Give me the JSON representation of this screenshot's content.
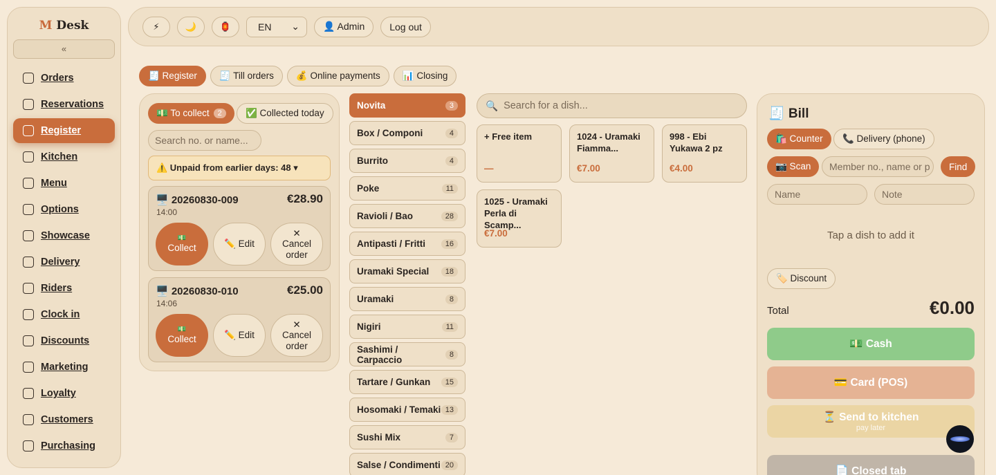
{
  "sidebar": {
    "logo_mark": "M",
    "logo_text": "Desk",
    "collapse_label": "«",
    "items": [
      {
        "label": "Orders",
        "icon": "clipboard-icon"
      },
      {
        "label": "Reservations",
        "icon": "calendar-icon"
      },
      {
        "label": "Register",
        "icon": "calculator-icon",
        "active": true
      },
      {
        "label": "Kitchen",
        "icon": "chef-hat-icon"
      },
      {
        "label": "Menu",
        "icon": "book-icon"
      },
      {
        "label": "Options",
        "icon": "list-check-icon"
      },
      {
        "label": "Showcase",
        "icon": "monitor-icon"
      },
      {
        "label": "Delivery",
        "icon": "truck-icon"
      },
      {
        "label": "Riders",
        "icon": "bike-icon"
      },
      {
        "label": "Clock in",
        "icon": "clock-icon"
      },
      {
        "label": "Discounts",
        "icon": "ticket-icon"
      },
      {
        "label": "Marketing",
        "icon": "megaphone-icon"
      },
      {
        "label": "Loyalty",
        "icon": "crown-icon"
      },
      {
        "label": "Customers",
        "icon": "users-icon"
      },
      {
        "label": "Purchasing",
        "icon": "cart-icon"
      }
    ]
  },
  "topbar": {
    "icon1": "⚡",
    "icon2": "🌙",
    "icon3": "🏮",
    "language": "EN",
    "user_label": "👤 Admin",
    "logout_label": "Log out"
  },
  "tabs": [
    {
      "label": "🧾 Register",
      "active": true
    },
    {
      "label": "🧾 Till orders"
    },
    {
      "label": "💰 Online payments"
    },
    {
      "label": "📊 Closing"
    }
  ],
  "orders": {
    "to_collect_label": "💵 To collect",
    "to_collect_count": "2",
    "collected_label": "✅ Collected today",
    "search_placeholder": "Search no. or name...",
    "unpaid_label": "⚠️ Unpaid from earlier days: 48 ▾",
    "cards": [
      {
        "id": "🖥️ 20260830-009",
        "amount": "€28.90",
        "time": "14:00"
      },
      {
        "id": "🖥️ 20260830-010",
        "amount": "€25.00",
        "time": "14:06"
      }
    ],
    "collect_icon": "💵",
    "collect_label": "Collect",
    "edit_label": "✏️ Edit",
    "cancel_icon": "✕",
    "cancel_label": "Cancel order"
  },
  "categories": [
    {
      "name": "Novita",
      "count": "3",
      "active": true
    },
    {
      "name": "Box / Componi",
      "count": "4"
    },
    {
      "name": "Burrito",
      "count": "4"
    },
    {
      "name": "Poke",
      "count": "11"
    },
    {
      "name": "Ravioli / Bao",
      "count": "28"
    },
    {
      "name": "Antipasti / Fritti",
      "count": "16"
    },
    {
      "name": "Uramaki Special",
      "count": "18"
    },
    {
      "name": "Uramaki",
      "count": "8"
    },
    {
      "name": "Nigiri",
      "count": "11"
    },
    {
      "name": "Sashimi / Carpaccio",
      "count": "8"
    },
    {
      "name": "Tartare / Gunkan",
      "count": "15"
    },
    {
      "name": "Hosomaki / Temaki",
      "count": "13"
    },
    {
      "name": "Sushi Mix",
      "count": "7"
    },
    {
      "name": "Salse / Condimenti",
      "count": "20"
    }
  ],
  "dishes": {
    "search_placeholder": "Search for a dish...",
    "items": [
      {
        "name": "+ Free item",
        "price": "—"
      },
      {
        "name": "1024 - Uramaki Fiamma...",
        "price": "€7.00"
      },
      {
        "name": "998 - Ebi Yukawa 2 pz",
        "price": "€4.00"
      },
      {
        "name": "1025 - Uramaki Perla di Scamp...",
        "price": "€7.00"
      }
    ]
  },
  "bill": {
    "title": "🧾 Bill",
    "counter_label": "🛍️ Counter",
    "delivery_label": "📞 Delivery (phone)",
    "scan_label": "📷 Scan",
    "member_placeholder": "Member no., name or p",
    "find_label": "Find",
    "name_placeholder": "Name",
    "note_placeholder": "Note",
    "empty_hint": "Tap a dish to add it",
    "discount_label": "🏷️ Discount",
    "total_label": "Total",
    "total_value": "€0.00",
    "cash_label": "💵 Cash",
    "card_label": "💳 Card (POS)",
    "kitchen_label": "⏳ Send to kitchen",
    "kitchen_sub": "pay later",
    "closed_label": "📄 Closed tab"
  },
  "colors": {
    "accent": "#c96d3c",
    "cash": "#8fcb8a",
    "card": "#e5b394",
    "kitchen": "#ebd5a4",
    "closed": "#c0b5a8"
  }
}
